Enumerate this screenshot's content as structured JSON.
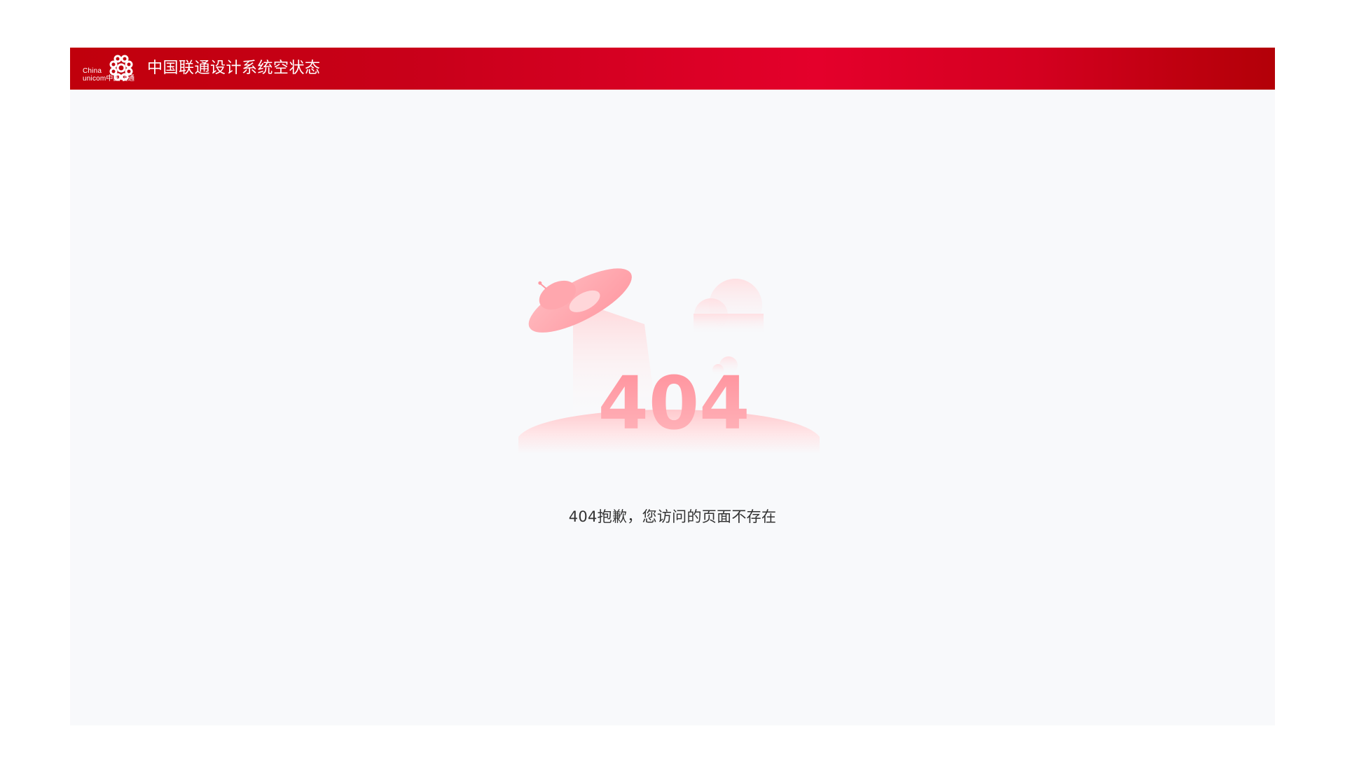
{
  "header": {
    "logo": {
      "icon": "china-unicom-knot-icon",
      "latin_line1": "China",
      "latin_line2": "unicom中国联通"
    },
    "title": "中国联通设计系统空状态"
  },
  "main": {
    "illustration": {
      "code": "404",
      "icon": "ufo-404-illustration"
    },
    "message": "404抱歉，您访问的页面不存在"
  },
  "colors": {
    "brand_red": "#e4002b",
    "brand_dark": "#b30008",
    "page_bg": "#f8f9fb",
    "text": "#333333",
    "illustration_pink": "#ff9ea6"
  }
}
